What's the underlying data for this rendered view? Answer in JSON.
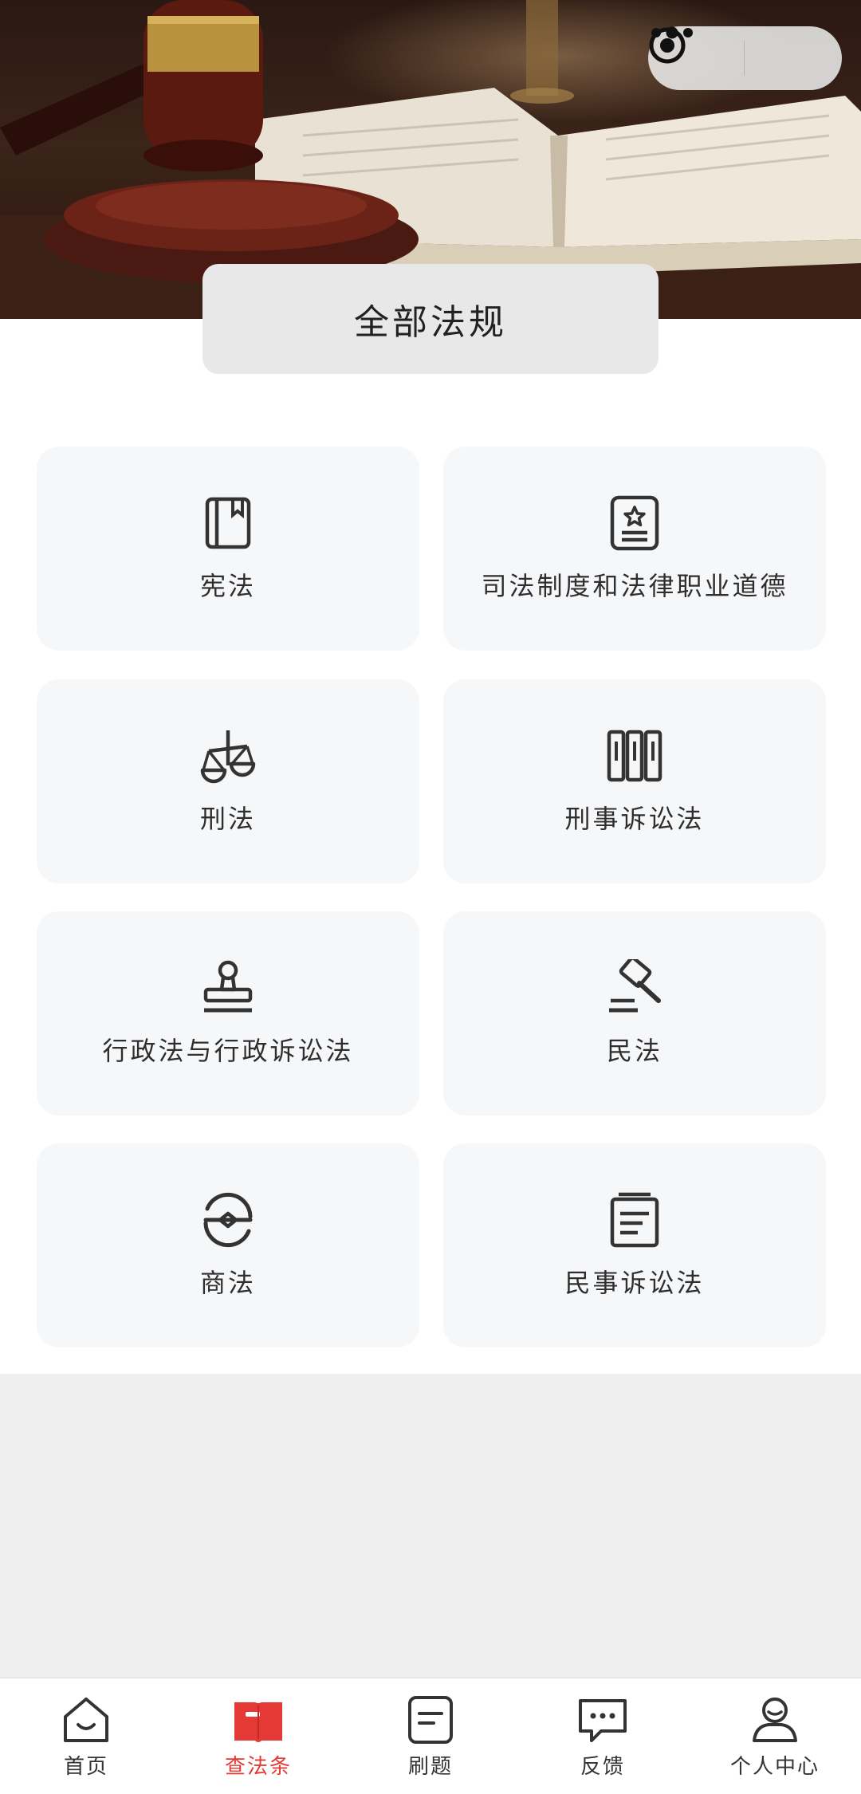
{
  "header": {
    "section_title": "全部法规"
  },
  "categories": [
    {
      "label": "宪法",
      "icon": "book-icon"
    },
    {
      "label": "司法制度和法律职业道德",
      "icon": "certificate-icon"
    },
    {
      "label": "刑法",
      "icon": "scales-icon"
    },
    {
      "label": "刑事诉讼法",
      "icon": "binders-icon"
    },
    {
      "label": "行政法与行政诉讼法",
      "icon": "stamp-icon"
    },
    {
      "label": "民法",
      "icon": "gavel-icon"
    },
    {
      "label": "商法",
      "icon": "commerce-icon"
    },
    {
      "label": "民事诉讼法",
      "icon": "document-icon"
    }
  ],
  "tabbar": {
    "items": [
      {
        "label": "首页",
        "icon": "home-icon",
        "active": false
      },
      {
        "label": "查法条",
        "icon": "law-book-icon",
        "active": true
      },
      {
        "label": "刷题",
        "icon": "notes-icon",
        "active": false
      },
      {
        "label": "反馈",
        "icon": "chat-icon",
        "active": false
      },
      {
        "label": "个人中心",
        "icon": "user-icon",
        "active": false
      }
    ]
  },
  "colors": {
    "accent": "#e53935",
    "card_bg": "#f6f7f9",
    "page_bg": "#efefef"
  }
}
